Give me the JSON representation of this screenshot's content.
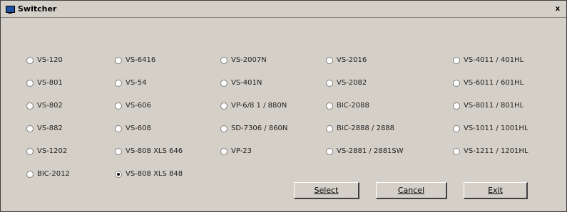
{
  "window": {
    "title": "Switcher",
    "close_label": "x"
  },
  "radio_options": [
    {
      "label": "VS-120",
      "checked": false
    },
    {
      "label": "VS-801",
      "checked": false
    },
    {
      "label": "VS-802",
      "checked": false
    },
    {
      "label": "VS-882",
      "checked": false
    },
    {
      "label": "VS-1202",
      "checked": false
    },
    {
      "label": "BIC-2012",
      "checked": false
    },
    {
      "label": "VS-6416",
      "checked": false
    },
    {
      "label": "VS-54",
      "checked": false
    },
    {
      "label": "VS-606",
      "checked": false
    },
    {
      "label": "VS-608",
      "checked": false
    },
    {
      "label": "VS-808 XLS 646",
      "checked": false
    },
    {
      "label": "VS-808 XLS 848",
      "checked": true
    },
    {
      "label": "VS-2007N",
      "checked": false
    },
    {
      "label": "VS-401N",
      "checked": false
    },
    {
      "label": "VP-6/8 1 / 880N",
      "checked": false
    },
    {
      "label": "SD-7306 / 860N",
      "checked": false
    },
    {
      "label": "VP-23",
      "checked": false
    },
    {
      "label": "VS-2016",
      "checked": false
    },
    {
      "label": "VS-2082",
      "checked": false
    },
    {
      "label": "BIC-2088",
      "checked": false
    },
    {
      "label": "BIC-2888 / 2888",
      "checked": false
    },
    {
      "label": "VS-2881 / 2881SW",
      "checked": false
    },
    {
      "label": "VS-4011 / 401HL",
      "checked": false
    },
    {
      "label": "VS-6011 / 601HL",
      "checked": false
    },
    {
      "label": "VS-8011 / 801HL",
      "checked": false
    },
    {
      "label": "VS-1011 / 1001HL",
      "checked": false
    },
    {
      "label": "VS-1211 / 1201HL",
      "checked": false
    }
  ],
  "buttons": {
    "select_label": "Select",
    "cancel_label": "Cancel",
    "exit_label": "Exit"
  }
}
